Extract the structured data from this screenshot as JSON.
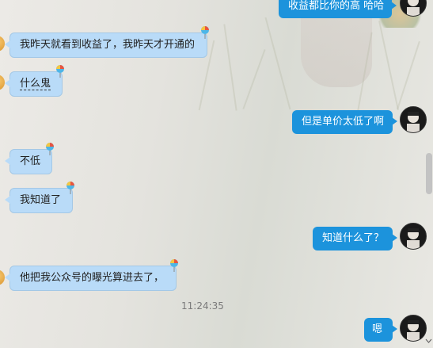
{
  "messages": [
    {
      "side": "right",
      "text": "收益都比你的高 哈哈"
    },
    {
      "side": "left",
      "text": "我昨天就看到收益了，我昨天才开通的"
    },
    {
      "side": "left",
      "text": "什么鬼"
    },
    {
      "side": "right",
      "text": "但是单价太低了啊"
    },
    {
      "side": "left",
      "text": "不低"
    },
    {
      "side": "left",
      "text": "我知道了"
    },
    {
      "side": "right",
      "text": "知道什么了？"
    },
    {
      "side": "left",
      "text": "他把我公众号的曝光算进去了，"
    },
    {
      "side": "right",
      "text": "嗯"
    }
  ],
  "timestamp": "11:24:35",
  "colors": {
    "left_bubble": "#b9dbf8",
    "right_bubble": "#1c93dc"
  },
  "icons": {
    "sticker": "balloon-sticker-icon",
    "avatar": "contact-avatar-icon"
  }
}
